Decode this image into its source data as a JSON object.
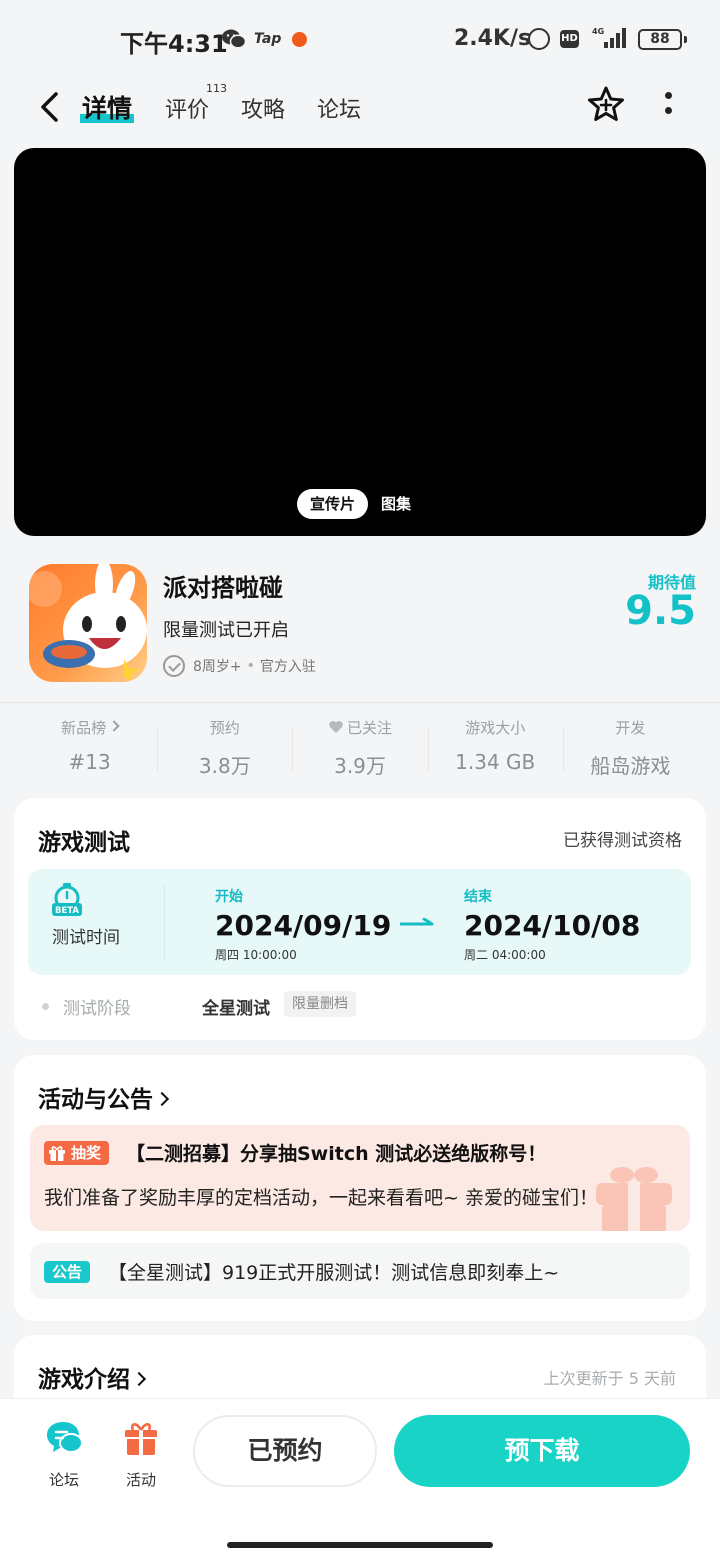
{
  "status_bar": {
    "time": "下午4:31",
    "tap_label": "Tap",
    "net_speed": "2.4K/s",
    "hd": "HD",
    "network": "4G",
    "battery": "88"
  },
  "nav": {
    "tabs": [
      {
        "label": "详情",
        "active": true
      },
      {
        "label": "评价",
        "badge": "113"
      },
      {
        "label": "攻略"
      },
      {
        "label": "论坛"
      }
    ]
  },
  "video": {
    "tabs": [
      "宣传片",
      "图集"
    ]
  },
  "game": {
    "title": "派对搭啦碰",
    "subtitle": "限量测试已开启",
    "age": "8周岁+",
    "official": "官方入驻",
    "expect_label": "期待值",
    "expect_value": "9.5"
  },
  "stats": [
    {
      "label": "新品榜",
      "value": "#13"
    },
    {
      "label": "预约",
      "value": "3.8万"
    },
    {
      "label": "已关注",
      "value": "3.9万"
    },
    {
      "label": "游戏大小",
      "value": "1.34 GB"
    },
    {
      "label": "开发",
      "value": "船岛游戏"
    }
  ],
  "test": {
    "title": "游戏测试",
    "qualification": "已获得测试资格",
    "beta_badge": "BETA",
    "time_label": "测试时间",
    "start_label": "开始",
    "start_date": "2024/09/19",
    "start_time": "周四  10:00:00",
    "end_label": "结束",
    "end_date": "2024/10/08",
    "end_time": "周二  04:00:00",
    "phase_label": "测试阶段",
    "phase_value": "全星测试",
    "phase_tag": "限量删档"
  },
  "activities": {
    "title": "活动与公告",
    "items": [
      {
        "tag": "抽奖",
        "title": "【二测招募】分享抽Switch 测试必送绝版称号！",
        "body": "我们准备了奖励丰厚的定档活动，一起来看看吧~ 亲爱的碰宝们！"
      },
      {
        "tag": "公告",
        "title": "【全星测试】919正式开服测试！测试信息即刻奉上~"
      }
    ]
  },
  "intro": {
    "title": "游戏介绍",
    "updated": "上次更新于 5 天前"
  },
  "bottom": {
    "forum": "论坛",
    "activity": "活动",
    "reserved": "已预约",
    "predownload": "预下载"
  },
  "colors": {
    "accent": "#15c5ce",
    "download": "#19d3c6",
    "lottery": "#f46a45"
  }
}
